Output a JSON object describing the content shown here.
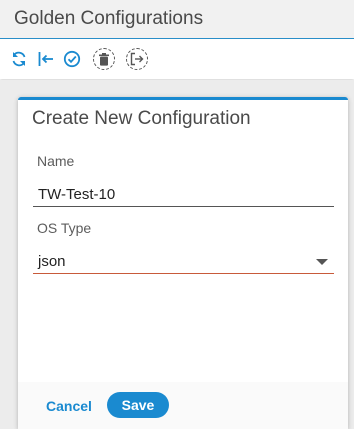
{
  "header": {
    "title": "Golden Configurations"
  },
  "toolbar": {
    "icons": [
      "refresh-icon",
      "back-arrow-icon",
      "check-circle-icon",
      "trash-icon",
      "exit-icon"
    ],
    "accent_color": "#1a8ad0"
  },
  "dialog": {
    "title": "Create New Configuration",
    "name_label": "Name",
    "name_value": "TW-Test-10",
    "os_type_label": "OS Type",
    "os_type_value": "json",
    "cancel_label": "Cancel",
    "save_label": "Save"
  },
  "colors": {
    "accent": "#1a8ad0",
    "name_underline": "#555555",
    "os_underline": "#c85a3a"
  }
}
